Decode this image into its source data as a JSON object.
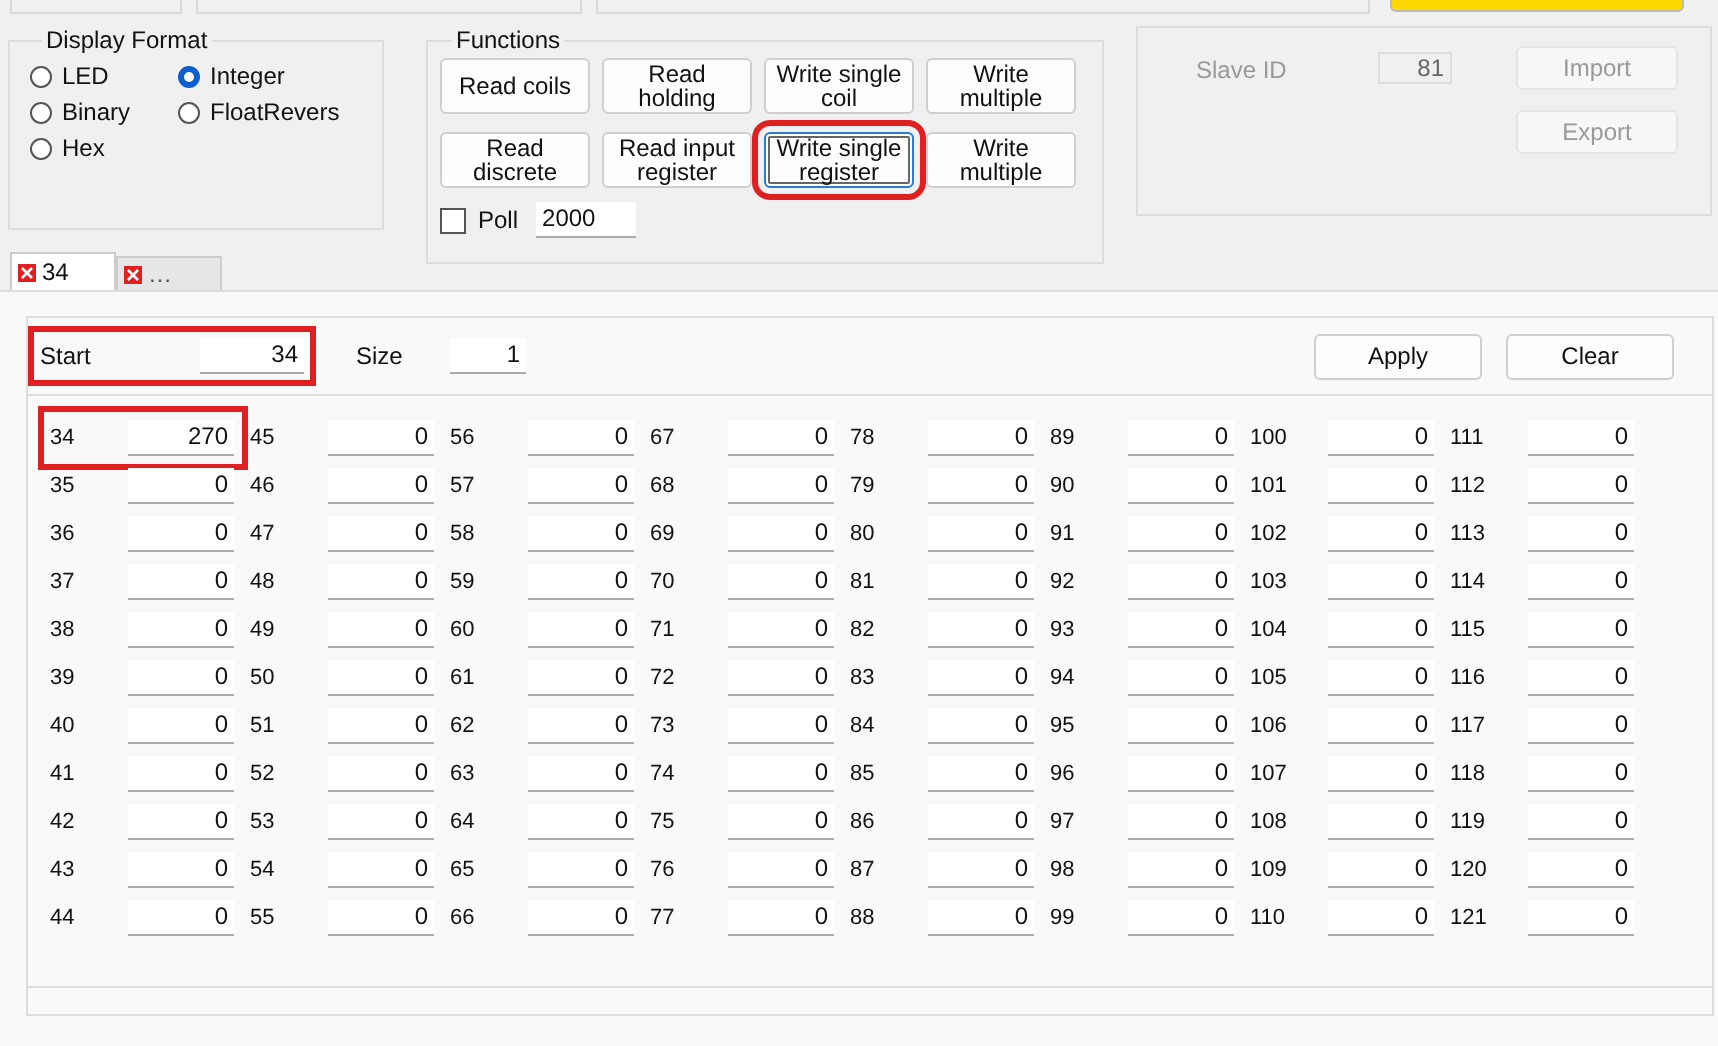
{
  "display_format": {
    "title": "Display Format",
    "options": [
      {
        "label": "LED",
        "selected": false
      },
      {
        "label": "Integer",
        "selected": true
      },
      {
        "label": "Binary",
        "selected": false
      },
      {
        "label": "FloatRevers",
        "selected": false
      },
      {
        "label": "Hex",
        "selected": false
      }
    ]
  },
  "functions": {
    "title": "Functions",
    "buttons": [
      {
        "label": "Read coils",
        "focused": false,
        "highlighted": false
      },
      {
        "label": "Read holding",
        "focused": false,
        "highlighted": false
      },
      {
        "label": "Write single coil",
        "focused": false,
        "highlighted": false
      },
      {
        "label": "Write multiple",
        "focused": false,
        "highlighted": false
      },
      {
        "label": "Read discrete",
        "focused": false,
        "highlighted": false
      },
      {
        "label": "Read input register",
        "focused": false,
        "highlighted": false
      },
      {
        "label": "Write single register",
        "focused": true,
        "highlighted": true
      },
      {
        "label": "Write multiple",
        "focused": false,
        "highlighted": false
      }
    ],
    "poll": {
      "label": "Poll",
      "checked": false,
      "interval": "2000"
    }
  },
  "device": {
    "slave_id_label": "Slave ID",
    "slave_id": "81",
    "buttons": [
      "Import",
      "Export"
    ]
  },
  "tabs": [
    {
      "label": "34",
      "selected": true
    },
    {
      "label": "…",
      "selected": false
    }
  ],
  "range": {
    "start_label": "Start",
    "start": "34",
    "start_highlighted": true,
    "size_label": "Size",
    "size": "1",
    "buttons": [
      "Apply",
      "Clear"
    ]
  },
  "registers": [
    {
      "address": "34",
      "value": "270",
      "highlighted": true
    },
    {
      "address": "35",
      "value": "0",
      "highlighted": false
    },
    {
      "address": "36",
      "value": "0",
      "highlighted": false
    },
    {
      "address": "37",
      "value": "0",
      "highlighted": false
    },
    {
      "address": "38",
      "value": "0",
      "highlighted": false
    },
    {
      "address": "39",
      "value": "0",
      "highlighted": false
    },
    {
      "address": "40",
      "value": "0",
      "highlighted": false
    },
    {
      "address": "41",
      "value": "0",
      "highlighted": false
    },
    {
      "address": "42",
      "value": "0",
      "highlighted": false
    },
    {
      "address": "43",
      "value": "0",
      "highlighted": false
    },
    {
      "address": "44",
      "value": "0",
      "highlighted": false
    },
    {
      "address": "45",
      "value": "0",
      "highlighted": false
    },
    {
      "address": "46",
      "value": "0",
      "highlighted": false
    },
    {
      "address": "47",
      "value": "0",
      "highlighted": false
    },
    {
      "address": "48",
      "value": "0",
      "highlighted": false
    },
    {
      "address": "49",
      "value": "0",
      "highlighted": false
    },
    {
      "address": "50",
      "value": "0",
      "highlighted": false
    },
    {
      "address": "51",
      "value": "0",
      "highlighted": false
    },
    {
      "address": "52",
      "value": "0",
      "highlighted": false
    },
    {
      "address": "53",
      "value": "0",
      "highlighted": false
    },
    {
      "address": "54",
      "value": "0",
      "highlighted": false
    },
    {
      "address": "55",
      "value": "0",
      "highlighted": false
    },
    {
      "address": "56",
      "value": "0",
      "highlighted": false
    },
    {
      "address": "57",
      "value": "0",
      "highlighted": false
    },
    {
      "address": "58",
      "value": "0",
      "highlighted": false
    },
    {
      "address": "59",
      "value": "0",
      "highlighted": false
    },
    {
      "address": "60",
      "value": "0",
      "highlighted": false
    },
    {
      "address": "61",
      "value": "0",
      "highlighted": false
    },
    {
      "address": "62",
      "value": "0",
      "highlighted": false
    },
    {
      "address": "63",
      "value": "0",
      "highlighted": false
    },
    {
      "address": "64",
      "value": "0",
      "highlighted": false
    },
    {
      "address": "65",
      "value": "0",
      "highlighted": false
    },
    {
      "address": "66",
      "value": "0",
      "highlighted": false
    },
    {
      "address": "67",
      "value": "0",
      "highlighted": false
    },
    {
      "address": "68",
      "value": "0",
      "highlighted": false
    },
    {
      "address": "69",
      "value": "0",
      "highlighted": false
    },
    {
      "address": "70",
      "value": "0",
      "highlighted": false
    },
    {
      "address": "71",
      "value": "0",
      "highlighted": false
    },
    {
      "address": "72",
      "value": "0",
      "highlighted": false
    },
    {
      "address": "73",
      "value": "0",
      "highlighted": false
    },
    {
      "address": "74",
      "value": "0",
      "highlighted": false
    },
    {
      "address": "75",
      "value": "0",
      "highlighted": false
    },
    {
      "address": "76",
      "value": "0",
      "highlighted": false
    },
    {
      "address": "77",
      "value": "0",
      "highlighted": false
    },
    {
      "address": "78",
      "value": "0",
      "highlighted": false
    },
    {
      "address": "79",
      "value": "0",
      "highlighted": false
    },
    {
      "address": "80",
      "value": "0",
      "highlighted": false
    },
    {
      "address": "81",
      "value": "0",
      "highlighted": false
    },
    {
      "address": "82",
      "value": "0",
      "highlighted": false
    },
    {
      "address": "83",
      "value": "0",
      "highlighted": false
    },
    {
      "address": "84",
      "value": "0",
      "highlighted": false
    },
    {
      "address": "85",
      "value": "0",
      "highlighted": false
    },
    {
      "address": "86",
      "value": "0",
      "highlighted": false
    },
    {
      "address": "87",
      "value": "0",
      "highlighted": false
    },
    {
      "address": "88",
      "value": "0",
      "highlighted": false
    },
    {
      "address": "89",
      "value": "0",
      "highlighted": false
    },
    {
      "address": "90",
      "value": "0",
      "highlighted": false
    },
    {
      "address": "91",
      "value": "0",
      "highlighted": false
    },
    {
      "address": "92",
      "value": "0",
      "highlighted": false
    },
    {
      "address": "93",
      "value": "0",
      "highlighted": false
    },
    {
      "address": "94",
      "value": "0",
      "highlighted": false
    },
    {
      "address": "95",
      "value": "0",
      "highlighted": false
    },
    {
      "address": "96",
      "value": "0",
      "highlighted": false
    },
    {
      "address": "97",
      "value": "0",
      "highlighted": false
    },
    {
      "address": "98",
      "value": "0",
      "highlighted": false
    },
    {
      "address": "99",
      "value": "0",
      "highlighted": false
    },
    {
      "address": "100",
      "value": "0",
      "highlighted": false
    },
    {
      "address": "101",
      "value": "0",
      "highlighted": false
    },
    {
      "address": "102",
      "value": "0",
      "highlighted": false
    },
    {
      "address": "103",
      "value": "0",
      "highlighted": false
    },
    {
      "address": "104",
      "value": "0",
      "highlighted": false
    },
    {
      "address": "105",
      "value": "0",
      "highlighted": false
    },
    {
      "address": "106",
      "value": "0",
      "highlighted": false
    },
    {
      "address": "107",
      "value": "0",
      "highlighted": false
    },
    {
      "address": "108",
      "value": "0",
      "highlighted": false
    },
    {
      "address": "109",
      "value": "0",
      "highlighted": false
    },
    {
      "address": "110",
      "value": "0",
      "highlighted": false
    },
    {
      "address": "111",
      "value": "0",
      "highlighted": false
    },
    {
      "address": "112",
      "value": "0",
      "highlighted": false
    },
    {
      "address": "113",
      "value": "0",
      "highlighted": false
    },
    {
      "address": "114",
      "value": "0",
      "highlighted": false
    },
    {
      "address": "115",
      "value": "0",
      "highlighted": false
    },
    {
      "address": "116",
      "value": "0",
      "highlighted": false
    },
    {
      "address": "117",
      "value": "0",
      "highlighted": false
    },
    {
      "address": "118",
      "value": "0",
      "highlighted": false
    },
    {
      "address": "119",
      "value": "0",
      "highlighted": false
    },
    {
      "address": "120",
      "value": "0",
      "highlighted": false
    },
    {
      "address": "121",
      "value": "0",
      "highlighted": false
    }
  ]
}
